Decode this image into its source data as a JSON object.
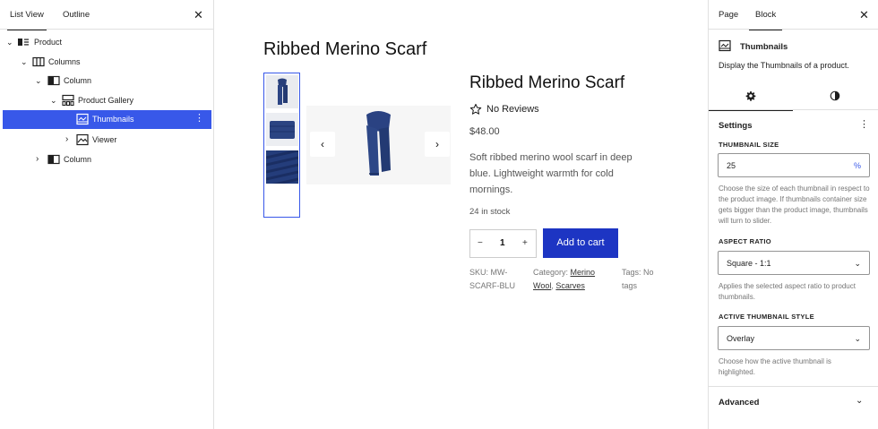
{
  "left_panel": {
    "tabs": [
      "List View",
      "Outline"
    ],
    "tree": [
      {
        "label": "Product",
        "icon": "product-icon",
        "expanded": true
      },
      {
        "label": "Columns",
        "icon": "columns-icon",
        "expanded": true
      },
      {
        "label": "Column",
        "icon": "column-icon",
        "expanded": true
      },
      {
        "label": "Product Gallery",
        "icon": "gallery-icon",
        "expanded": true
      },
      {
        "label": "Thumbnails",
        "icon": "thumbnails-icon",
        "selected": true
      },
      {
        "label": "Viewer",
        "icon": "image-icon",
        "expanded": false
      },
      {
        "label": "Column",
        "icon": "column-icon",
        "expanded": false
      }
    ]
  },
  "canvas": {
    "page_title": "Ribbed Merino Scarf",
    "product": {
      "title": "Ribbed Merino Scarf",
      "reviews": "No Reviews",
      "price": "$48.00",
      "description": "Soft ribbed merino wool scarf in deep blue. Lightweight warmth for cold mornings.",
      "stock": "24 in stock",
      "quantity": "1",
      "qty_minus": "−",
      "qty_plus": "+",
      "add_to_cart": "Add to cart",
      "sku_label": "SKU: MW-",
      "sku_value": "SCARF-BLU",
      "category_label": "Category:",
      "category_link1": "Merino",
      "category_link2": "Wool",
      "category_sep": ",",
      "category_link3": "Scarves",
      "tags_label": "Tags: No",
      "tags_value": "tags"
    },
    "colors": {
      "accent": "#3858e9",
      "button": "#1d35c3",
      "scarf": "#283f7a"
    }
  },
  "right_panel": {
    "tabs": [
      "Page",
      "Block"
    ],
    "block_name": "Thumbnails",
    "block_description": "Display the Thumbnails of a product.",
    "subtab_icons": [
      "gear-icon",
      "contrast-icon"
    ],
    "settings_title": "Settings",
    "thumbnail_size": {
      "label": "THUMBNAIL SIZE",
      "value": "25",
      "unit": "%",
      "help": "Choose the size of each thumbnail in respect to the product image. If thumbnails container size gets bigger than the product image, thumbnails will turn to slider."
    },
    "aspect_ratio": {
      "label": "ASPECT RATIO",
      "value": "Square - 1:1",
      "help": "Applies the selected aspect ratio to product thumbnails."
    },
    "active_style": {
      "label": "ACTIVE THUMBNAIL STYLE",
      "value": "Overlay",
      "help": "Choose how the active thumbnail is highlighted."
    },
    "advanced": "Advanced"
  }
}
